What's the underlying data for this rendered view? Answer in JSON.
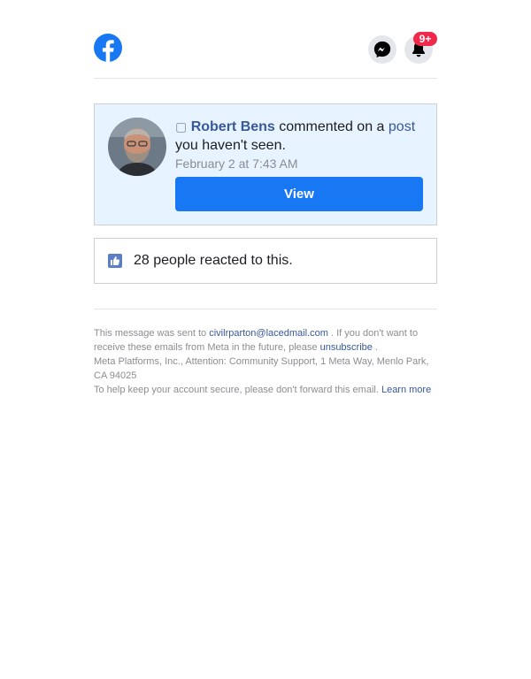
{
  "header": {
    "logo_icon": "facebook-logo-icon",
    "messenger_icon": "messenger-icon",
    "bell_icon": "bell-icon",
    "notification_badge": "9+",
    "brand_color": "#1877f2",
    "badge_color": "#f02849"
  },
  "notification": {
    "icon_glyph": "▢",
    "actor": "Robert Bens",
    "action": "commented on a",
    "object_link": "post",
    "tail": "you haven't seen.",
    "timestamp": "February 2 at 7:43 AM",
    "view_label": "View"
  },
  "reactions": {
    "icon": "like-icon",
    "count": "28",
    "text": "people reacted to this."
  },
  "footer": {
    "sent_prefix": "This message was sent to",
    "email": "civilrparton@lacedmail.com",
    "unsub_prefix": ". If you don't want to receive these emails from Meta in the future, please",
    "unsubscribe_label": "unsubscribe",
    "unsub_suffix": ".",
    "address": "Meta Platforms, Inc., Attention: Community Support, 1 Meta Way, Menlo Park, CA 94025",
    "security_text": "To help keep your account secure, please don't forward this email.",
    "learn_more_label": "Learn more"
  }
}
